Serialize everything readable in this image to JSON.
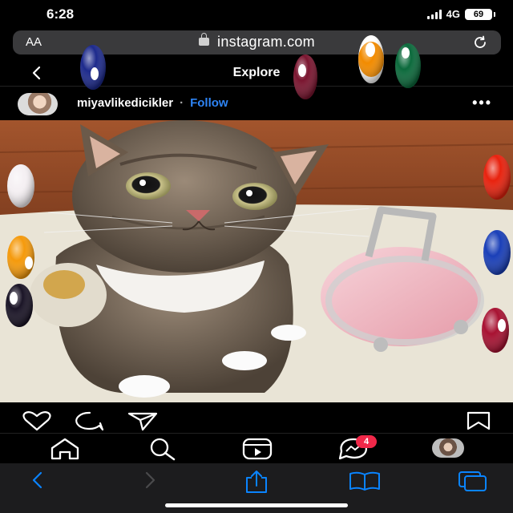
{
  "status": {
    "time": "6:28",
    "network": "4G",
    "battery": "69"
  },
  "browser": {
    "text_size_label": "AA",
    "url": "instagram.com",
    "icons": {
      "lock": "lock-icon",
      "reload": "reload-icon"
    }
  },
  "header": {
    "title": "Explore",
    "back_icon": "chevron-left-icon"
  },
  "post": {
    "username": "miyavlikedicikler",
    "separator": "·",
    "follow_label": "Follow",
    "more_label": "•••",
    "photo_icon": "cat-photo"
  },
  "actions": {
    "icons": [
      "heart-icon",
      "comment-icon",
      "share-icon",
      "bookmark-icon"
    ]
  },
  "tabs": {
    "icons": [
      "home-icon",
      "search-icon",
      "reels-icon",
      "messenger-icon",
      "profile-avatar"
    ],
    "messages_badge": "4"
  },
  "safari": {
    "icons": [
      "back-icon",
      "forward-icon",
      "share-icon",
      "bookmarks-icon",
      "tabs-icon"
    ]
  },
  "colors": {
    "background": "#000000",
    "link_blue": "#2e84f5",
    "url_bar": "#3a3a3c",
    "toolbar": "#1c1c1e",
    "badge_red": "#f02849",
    "safari_blue": "#0a84ff"
  }
}
